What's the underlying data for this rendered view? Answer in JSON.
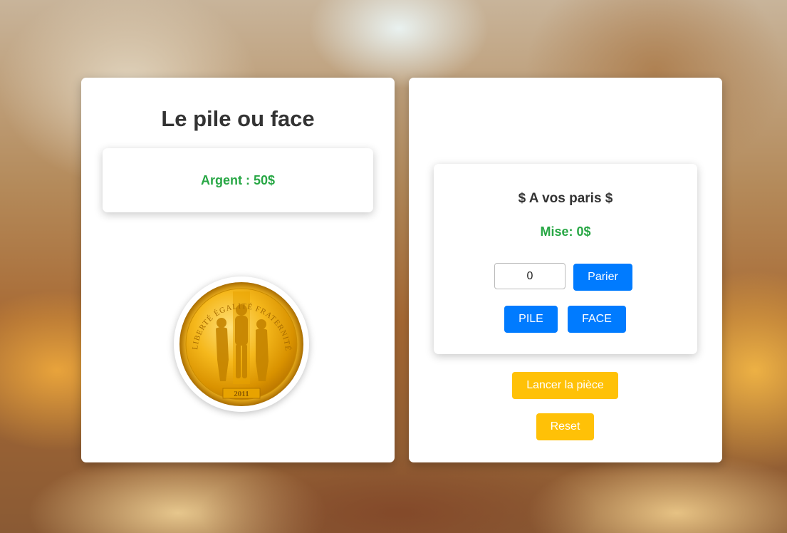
{
  "game": {
    "title": "Le pile ou face",
    "money_label": "Argent : 50$"
  },
  "coin": {
    "year": "2011",
    "legend": "LIBERTÉ ÉGALITÉ FRATERNITÉ"
  },
  "bet": {
    "title": "$ A vos paris $",
    "mise_label": "Mise: 0$",
    "input_value": "0",
    "parier_label": "Parier",
    "pile_label": "PILE",
    "face_label": "FACE"
  },
  "actions": {
    "lancer_label": "Lancer la pièce",
    "reset_label": "Reset"
  },
  "colors": {
    "primary": "#007bff",
    "warning": "#ffc107",
    "success": "#28a745",
    "coin_gold": "#e8a300"
  }
}
